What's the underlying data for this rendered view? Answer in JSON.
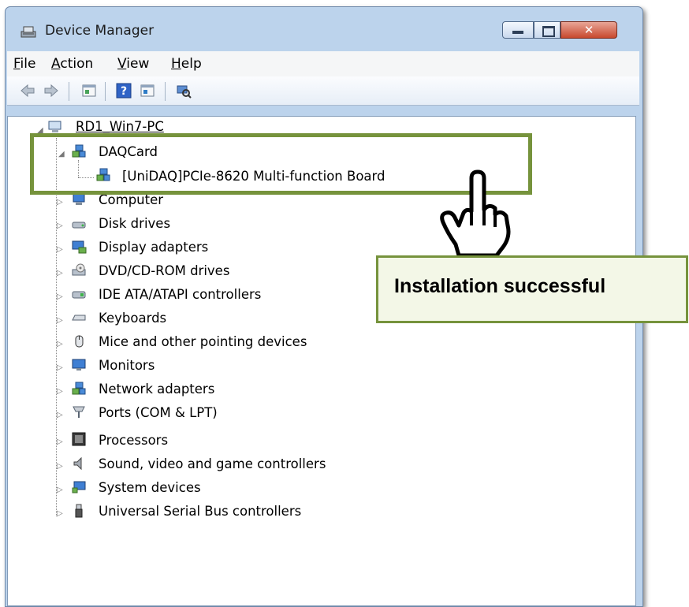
{
  "window": {
    "title": "Device Manager",
    "controls": [
      "minimize",
      "maximize",
      "close"
    ],
    "close_glyph": "✕"
  },
  "menu": [
    {
      "label": "File",
      "underline": "F"
    },
    {
      "label": "Action",
      "underline": "A"
    },
    {
      "label": "View",
      "underline": "V"
    },
    {
      "label": "Help",
      "underline": "H"
    }
  ],
  "toolbar": {
    "icons": [
      "back-arrow-icon",
      "forward-arrow-icon",
      "properties-icon",
      "help-icon",
      "update-driver-icon",
      "scan-hardware-icon"
    ]
  },
  "tree": {
    "root": "RD1_Win7-PC",
    "daq_group": "DAQCard",
    "daq_device": "[UniDAQ]PCIe-8620 Multi-function Board",
    "categories": [
      "Computer",
      "Disk drives",
      "Display adapters",
      "DVD/CD-ROM drives",
      "IDE ATA/ATAPI controllers",
      "Keyboards",
      "Mice and other pointing devices",
      "Monitors",
      "Network adapters",
      "Ports (COM & LPT)",
      "Processors",
      "Sound, video and game controllers",
      "System devices",
      "Universal Serial Bus controllers"
    ]
  },
  "annotation": {
    "callout_text": "Installation successful",
    "accent_color": "#76933c"
  }
}
